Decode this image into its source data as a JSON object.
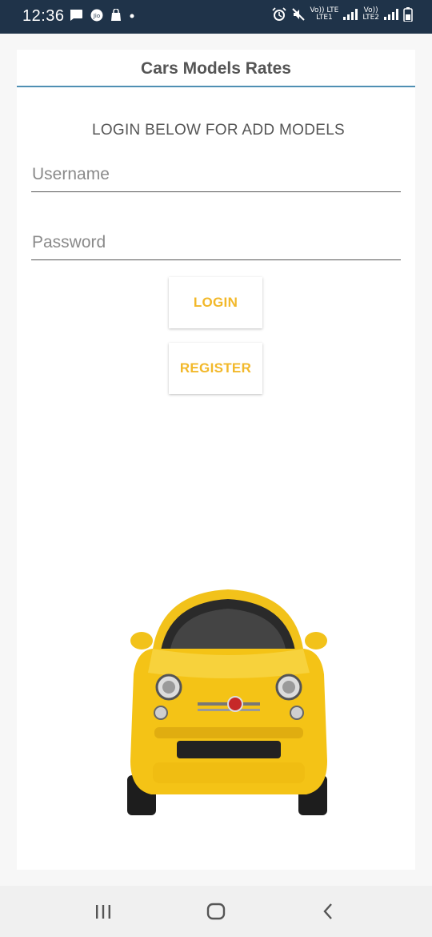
{
  "status_bar": {
    "time": "12:36",
    "net1_top": "Vo)) LTE",
    "net1_bottom": "LTE1",
    "net2_top": "Vo))",
    "net2_bottom": "LTE2",
    "icons": [
      "message-icon",
      "jio-icon",
      "bag-icon",
      "dot-icon",
      "alarm-icon",
      "mute-icon",
      "signal-icon",
      "battery-icon"
    ]
  },
  "app": {
    "title": "Cars Models Rates",
    "accent": "#4f8fb3"
  },
  "login": {
    "heading": "LOGIN BELOW FOR ADD MODELS",
    "username_placeholder": "Username",
    "password_placeholder": "Password",
    "login_label": "LOGIN",
    "register_label": "REGISTER",
    "button_color": "#f2b82a"
  },
  "nav": {
    "icons": [
      "recent-apps-icon",
      "home-icon",
      "back-icon"
    ]
  }
}
